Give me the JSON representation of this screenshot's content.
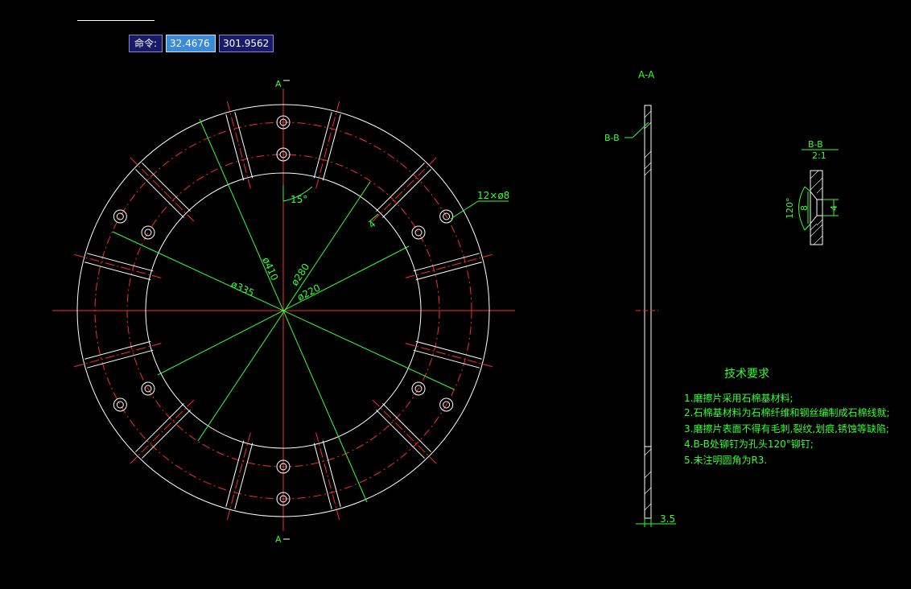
{
  "command": {
    "label": "命令:",
    "x_value": "32.4676",
    "y_value": "301.9562"
  },
  "main_view": {
    "section_mark": "A",
    "angle_label": "15°",
    "hole_note": "12×ø8",
    "dim_410": "ø410",
    "dim_335": "ø335",
    "dim_280": "ø280",
    "dim_220": "ø220",
    "dim_4": "4"
  },
  "section_view": {
    "title": "A-A",
    "bb_label": "B-B",
    "thickness": "3.5"
  },
  "detail_view": {
    "title": "B-B",
    "scale": "2:1",
    "angle": "120°",
    "dim_8": "8",
    "dim_4": "4"
  },
  "notes": {
    "title": "技术要求",
    "items": [
      "1.磨擦片采用石棉基材料;",
      "2.石棉基材料为石棉纤维和钢丝编制成石棉线就;",
      "3.磨擦片表面不得有毛刺,裂纹,划痕,锈蚀等缺陷;",
      "4.B-B处铆钉为孔头120°铆钉;",
      "5.未注明圆角为R3."
    ]
  },
  "colors": {
    "outline": "#ffffff",
    "center": "#ff2a2a",
    "dimension": "#33ff33"
  }
}
